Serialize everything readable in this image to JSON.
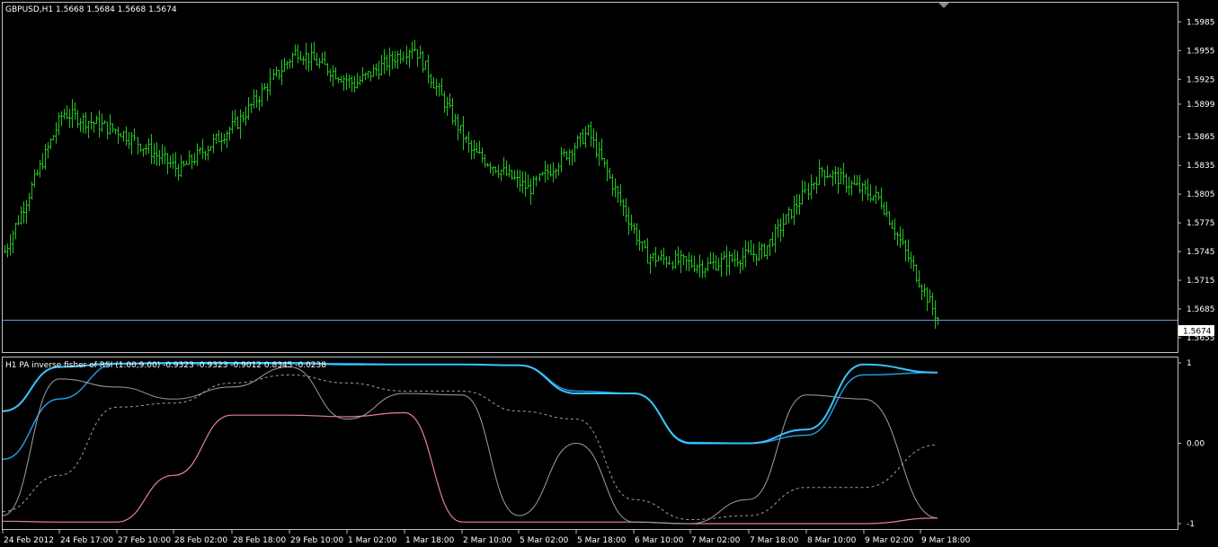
{
  "main_panel": {
    "header": "GBPUSD,H1  1.5668 1.5684 1.5668 1.5674",
    "symbol": "GBPUSD",
    "timeframe": "H1",
    "ohlc": {
      "open": 1.5668,
      "high": 1.5684,
      "low": 1.5668,
      "close": 1.5674
    },
    "current_price_label": "1.5674",
    "price_ticks": [
      "1.5985",
      "1.5955",
      "1.5925",
      "1.5899",
      "1.5865",
      "1.5835",
      "1.5805",
      "1.5775",
      "1.5745",
      "1.5715",
      "1.5685",
      "1.5655"
    ]
  },
  "indicator_panel": {
    "header": "H1 PA inverse fisher of RSI (1.00,9.00) -0.9323 -0.9323 -0.9012 0.8345 -0.0238",
    "name": "H1 PA inverse fisher of RSI (1.00,9.00)",
    "values": [
      -0.9323,
      -0.9323,
      -0.9012,
      0.8345,
      -0.0238
    ],
    "ticks": [
      "1",
      "0.00",
      "-1"
    ]
  },
  "time_axis": [
    "24 Feb 2012",
    "24 Feb 17:00",
    "27 Feb 10:00",
    "28 Feb 02:00",
    "28 Feb 18:00",
    "29 Feb 10:00",
    "1 Mar 02:00",
    "1 Mar 18:00",
    "2 Mar 10:00",
    "5 Mar 02:00",
    "5 Mar 18:00",
    "6 Mar 10:00",
    "7 Mar 02:00",
    "7 Mar 18:00",
    "8 Mar 10:00",
    "9 Mar 02:00",
    "9 Mar 18:00"
  ],
  "colors": {
    "background": "#000000",
    "bars": "#22c322",
    "grid_border": "#c0c0c0",
    "price_line": "#6a9ad8",
    "ifish_blue": "#1e9be0",
    "ifish_cyan": "#3bc3ff",
    "ifish_pink": "#e88090",
    "ifish_gray": "#a0a0a0",
    "dotted": "#a0a0a0"
  },
  "chart_data": [
    {
      "type": "line",
      "title": "GBPUSD,H1  1.5668 1.5684 1.5668 1.5674",
      "series": [
        {
          "name": "GBPUSD",
          "x": [
            "24 Feb 2012",
            "24 Feb 17:00",
            "27 Feb 10:00",
            "28 Feb 02:00",
            "28 Feb 18:00",
            "29 Feb 10:00",
            "1 Mar 02:00",
            "1 Mar 18:00",
            "2 Mar 10:00",
            "5 Mar 02:00",
            "5 Mar 18:00",
            "6 Mar 10:00",
            "7 Mar 02:00",
            "7 Mar 18:00",
            "8 Mar 10:00",
            "9 Mar 02:00",
            "9 Mar 18:00"
          ],
          "values": [
            1.5745,
            1.589,
            1.587,
            1.583,
            1.588,
            1.5955,
            1.592,
            1.596,
            1.585,
            1.581,
            1.587,
            1.574,
            1.573,
            1.5745,
            1.583,
            1.58,
            1.5674
          ]
        }
      ],
      "ylim": [
        1.564,
        1.6005
      ],
      "current_price": 1.5674
    },
    {
      "type": "line",
      "title": "H1 PA inverse fisher of RSI (1.00,9.00)",
      "x": [
        "24 Feb 2012",
        "24 Feb 17:00",
        "27 Feb 10:00",
        "28 Feb 02:00",
        "28 Feb 18:00",
        "29 Feb 10:00",
        "1 Mar 02:00",
        "1 Mar 18:00",
        "2 Mar 10:00",
        "5 Mar 02:00",
        "5 Mar 18:00",
        "6 Mar 10:00",
        "7 Mar 02:00",
        "7 Mar 18:00",
        "8 Mar 10:00",
        "9 Mar 02:00",
        "9 Mar 18:00"
      ],
      "series": [
        {
          "values": [
            -0.2,
            0.55,
            0.99,
            0.99,
            0.99,
            0.99,
            0.99,
            0.98,
            0.98,
            0.97,
            0.65,
            0.62,
            0.01,
            0.0,
            0.1,
            0.85,
            0.88
          ]
        },
        {
          "values": [
            0.4,
            0.95,
            0.99,
            1.0,
            1.0,
            1.0,
            0.98,
            0.98,
            0.98,
            0.97,
            0.62,
            0.62,
            0.0,
            0.0,
            0.17,
            0.98,
            0.88
          ]
        },
        {
          "values": [
            -0.97,
            -0.98,
            -0.98,
            -0.4,
            0.35,
            0.35,
            0.33,
            0.38,
            -0.98,
            -0.98,
            -0.98,
            -0.98,
            -1.0,
            -1.0,
            -1.0,
            -1.0,
            -0.93
          ]
        },
        {
          "values": [
            -0.9,
            0.8,
            0.7,
            0.55,
            0.7,
            0.95,
            0.3,
            0.62,
            0.6,
            -0.9,
            0.0,
            -0.98,
            -1.0,
            -0.7,
            0.6,
            0.55,
            -0.93
          ]
        },
        {
          "values": [
            -0.85,
            -0.4,
            0.45,
            0.5,
            0.75,
            0.85,
            0.75,
            0.65,
            0.65,
            0.4,
            0.3,
            -0.7,
            -0.95,
            -0.9,
            -0.55,
            -0.55,
            -0.02
          ]
        }
      ],
      "ylim": [
        -1,
        1
      ]
    }
  ]
}
